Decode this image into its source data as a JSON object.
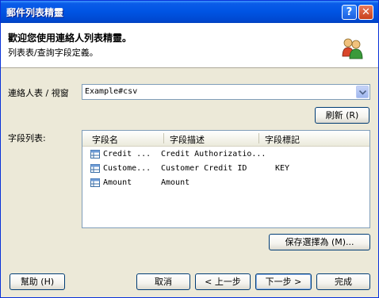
{
  "window": {
    "title": "郵件列表精靈",
    "help_glyph": "?",
    "close_glyph": "✕"
  },
  "header": {
    "title": "歡迎您使用連絡人列表精靈。",
    "subtitle": "列表表/查詢字段定義。",
    "icon": "people-icon"
  },
  "source": {
    "label": "連絡人表 / 視窗",
    "value": "Example#csv"
  },
  "refresh_button": "刷新 (R)",
  "fields": {
    "label": "字段列表:",
    "columns": [
      "字段名",
      "字段描述",
      "字段標記"
    ],
    "rows": [
      {
        "name": "Credit ...",
        "description": "Credit Authorizatio...",
        "tag": ""
      },
      {
        "name": "Custome...",
        "description": "Customer Credit ID",
        "tag": "KEY"
      },
      {
        "name": "Amount",
        "description": "Amount",
        "tag": ""
      }
    ]
  },
  "save_selection_button": "保存選擇為 (M)...",
  "footer": {
    "help": "幫助 (H)",
    "cancel": "取消",
    "back": "< 上一步",
    "next": "下一步 >",
    "finish": "完成"
  }
}
